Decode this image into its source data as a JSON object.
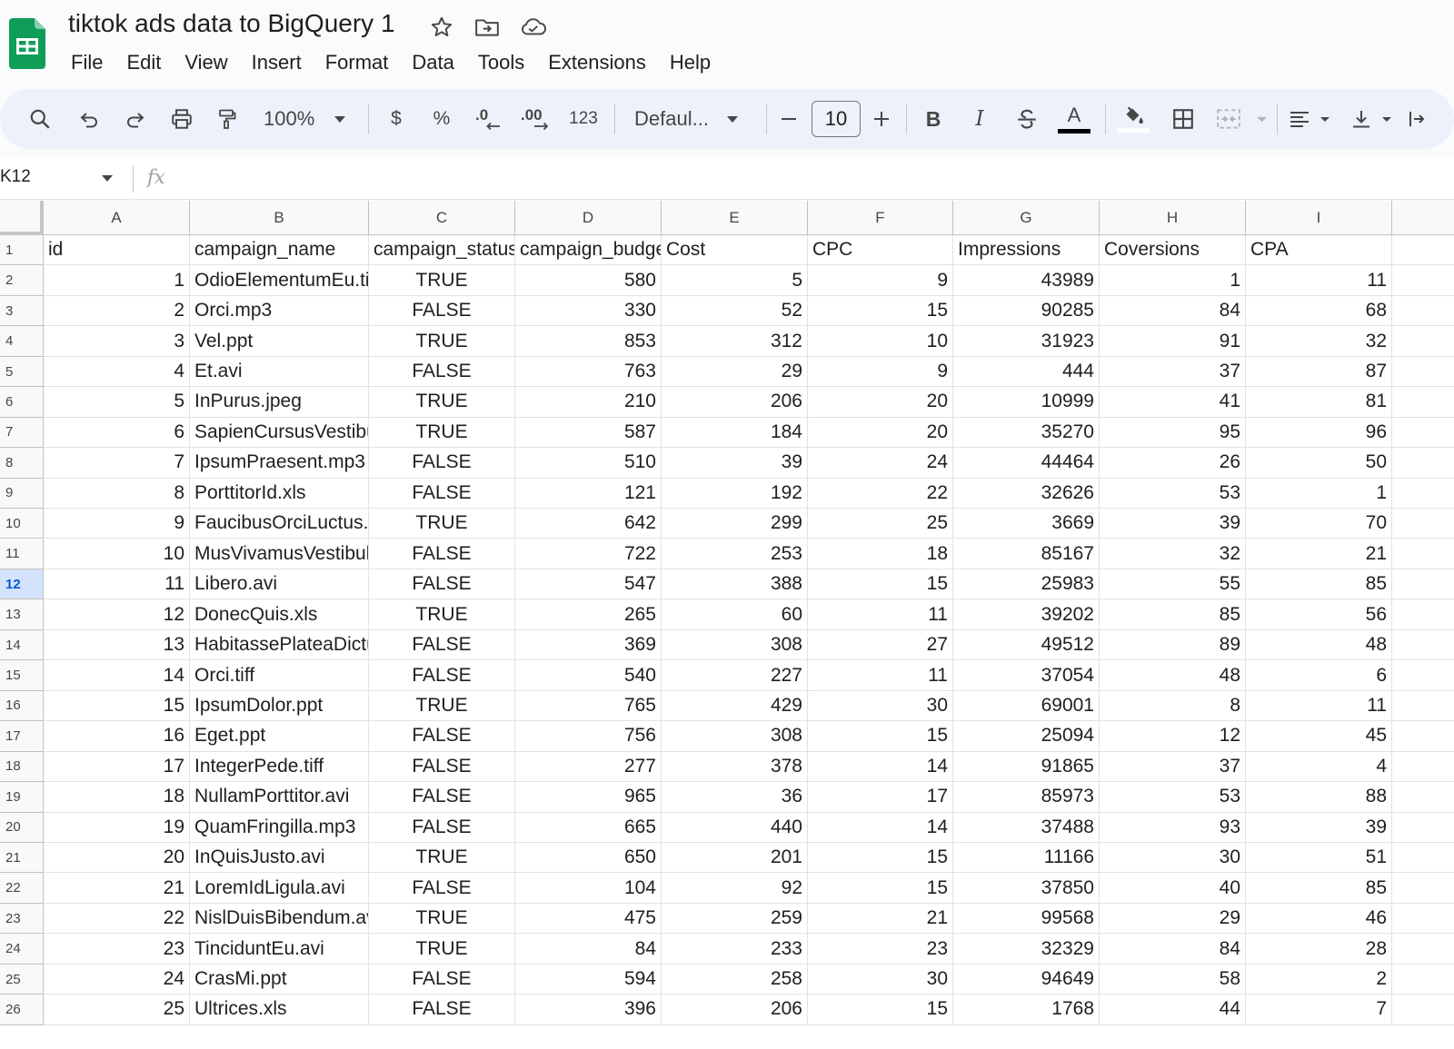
{
  "document": {
    "title": "tiktok ads data to BigQuery 1"
  },
  "title_icons": [
    "star-icon",
    "move-to-folder-icon",
    "cloud-status-icon"
  ],
  "menu": [
    "File",
    "Edit",
    "View",
    "Insert",
    "Format",
    "Data",
    "Tools",
    "Extensions",
    "Help"
  ],
  "toolbar": {
    "zoom": "100%",
    "currency": "$",
    "percent": "%",
    "decrease_decimal": ".0",
    "increase_decimal": ".00",
    "number_format": "123",
    "font": "Defaul...",
    "font_size": "10",
    "bold": "B",
    "italic": "I",
    "text_color_letter": "A"
  },
  "formula_bar": {
    "name_box": "K12",
    "fx": "fx",
    "value": ""
  },
  "grid": {
    "columns": [
      "A",
      "B",
      "C",
      "D",
      "E",
      "F",
      "G",
      "H",
      "I"
    ],
    "selected_row": 12,
    "header_row": [
      "id",
      "campaign_name",
      "campaign_status",
      "campaign_budget",
      "Cost",
      "CPC",
      "Impressions",
      "Coversions",
      "CPA"
    ],
    "rows": [
      [
        "1",
        "OdioElementumEu.tiff",
        "TRUE",
        "580",
        "5",
        "9",
        "43989",
        "1",
        "11"
      ],
      [
        "2",
        "Orci.mp3",
        "FALSE",
        "330",
        "52",
        "15",
        "90285",
        "84",
        "68"
      ],
      [
        "3",
        "Vel.ppt",
        "TRUE",
        "853",
        "312",
        "10",
        "31923",
        "91",
        "32"
      ],
      [
        "4",
        "Et.avi",
        "FALSE",
        "763",
        "29",
        "9",
        "444",
        "37",
        "87"
      ],
      [
        "5",
        "InPurus.jpeg",
        "TRUE",
        "210",
        "206",
        "20",
        "10999",
        "41",
        "81"
      ],
      [
        "6",
        "SapienCursusVestibulum",
        "TRUE",
        "587",
        "184",
        "20",
        "35270",
        "95",
        "96"
      ],
      [
        "7",
        "IpsumPraesent.mp3",
        "FALSE",
        "510",
        "39",
        "24",
        "44464",
        "26",
        "50"
      ],
      [
        "8",
        "PorttitorId.xls",
        "FALSE",
        "121",
        "192",
        "22",
        "32626",
        "53",
        "1"
      ],
      [
        "9",
        "FaucibusOrciLuctus.",
        "TRUE",
        "642",
        "299",
        "25",
        "3669",
        "39",
        "70"
      ],
      [
        "10",
        "MusVivamusVestibulum",
        "FALSE",
        "722",
        "253",
        "18",
        "85167",
        "32",
        "21"
      ],
      [
        "11",
        "Libero.avi",
        "FALSE",
        "547",
        "388",
        "15",
        "25983",
        "55",
        "85"
      ],
      [
        "12",
        "DonecQuis.xls",
        "TRUE",
        "265",
        "60",
        "11",
        "39202",
        "85",
        "56"
      ],
      [
        "13",
        "HabitassePlateaDictumst",
        "FALSE",
        "369",
        "308",
        "27",
        "49512",
        "89",
        "48"
      ],
      [
        "14",
        "Orci.tiff",
        "FALSE",
        "540",
        "227",
        "11",
        "37054",
        "48",
        "6"
      ],
      [
        "15",
        "IpsumDolor.ppt",
        "TRUE",
        "765",
        "429",
        "30",
        "69001",
        "8",
        "11"
      ],
      [
        "16",
        "Eget.ppt",
        "FALSE",
        "756",
        "308",
        "15",
        "25094",
        "12",
        "45"
      ],
      [
        "17",
        "IntegerPede.tiff",
        "FALSE",
        "277",
        "378",
        "14",
        "91865",
        "37",
        "4"
      ],
      [
        "18",
        "NullamPorttitor.avi",
        "FALSE",
        "965",
        "36",
        "17",
        "85973",
        "53",
        "88"
      ],
      [
        "19",
        "QuamFringilla.mp3",
        "FALSE",
        "665",
        "440",
        "14",
        "37488",
        "93",
        "39"
      ],
      [
        "20",
        "InQuisJusto.avi",
        "TRUE",
        "650",
        "201",
        "15",
        "11166",
        "30",
        "51"
      ],
      [
        "21",
        "LoremIdLigula.avi",
        "FALSE",
        "104",
        "92",
        "15",
        "37850",
        "40",
        "85"
      ],
      [
        "22",
        "NislDuisBibendum.avi",
        "TRUE",
        "475",
        "259",
        "21",
        "99568",
        "29",
        "46"
      ],
      [
        "23",
        "TinciduntEu.avi",
        "TRUE",
        "84",
        "233",
        "23",
        "32329",
        "84",
        "28"
      ],
      [
        "24",
        "CrasMi.ppt",
        "FALSE",
        "594",
        "258",
        "30",
        "94649",
        "58",
        "2"
      ],
      [
        "25",
        "Ultrices.xls",
        "FALSE",
        "396",
        "206",
        "15",
        "1768",
        "44",
        "7"
      ]
    ]
  },
  "colors": {
    "selection": "#d3e3fd",
    "selection_text": "#0b57d0",
    "sheets_green": "#0f9d58",
    "toolbar_bg": "#edf2fa"
  }
}
